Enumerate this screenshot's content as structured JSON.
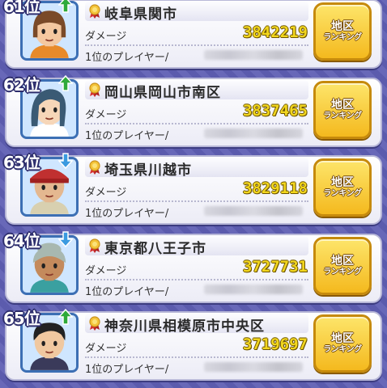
{
  "button": {
    "line1": "地区",
    "line2": "ランキング"
  },
  "entries": [
    {
      "rank": "61位",
      "trend": "up",
      "city": "岐阜県関市",
      "damage_label": "ダメージ",
      "damage": "3842219",
      "player_label": "1位のプレイヤー/",
      "avatar": {
        "hair": "#7a4a28",
        "skin": "#f4c8a0",
        "bg": "#cfe6ff",
        "shirt": "#e88a2a",
        "style": "bob"
      }
    },
    {
      "rank": "62位",
      "trend": "up",
      "city": "岡山県岡山市南区",
      "damage_label": "ダメージ",
      "damage": "3837465",
      "player_label": "1位のプレイヤー/",
      "avatar": {
        "hair": "#3a5a74",
        "skin": "#f6d6b8",
        "bg": "#cfe6ff",
        "shirt": "#ffffff",
        "style": "long"
      }
    },
    {
      "rank": "63位",
      "trend": "down",
      "city": "埼玉県川越市",
      "damage_label": "ダメージ",
      "damage": "3829118",
      "player_label": "1位のプレイヤー/",
      "avatar": {
        "hair": "#c03030",
        "skin": "#e4b890",
        "bg": "#cfe6ff",
        "shirt": "#d8d0b0",
        "style": "old"
      }
    },
    {
      "rank": "64位",
      "trend": "down",
      "city": "東京都八王子市",
      "damage_label": "ダメージ",
      "damage": "3727731",
      "player_label": "1位のプレイヤー/",
      "avatar": {
        "hair": "#a8b8b0",
        "skin": "#c48a5c",
        "bg": "#cfe6ff",
        "shirt": "#3aa0a0",
        "style": "grandma"
      }
    },
    {
      "rank": "65位",
      "trend": "up",
      "city": "神奈川県相模原市中央区",
      "damage_label": "ダメージ",
      "damage": "3719697",
      "player_label": "1位のプレイヤー/",
      "avatar": {
        "hair": "#222222",
        "skin": "#f0c8a0",
        "bg": "#cfe6ff",
        "shirt": "#3a3a5a",
        "style": "man"
      }
    }
  ],
  "colors": {
    "background": "#5f5fb4",
    "trend_up": "#2eaa3a",
    "trend_down": "#3a9ae0",
    "damage": "#f2d61e",
    "button": "#f4b91e"
  }
}
